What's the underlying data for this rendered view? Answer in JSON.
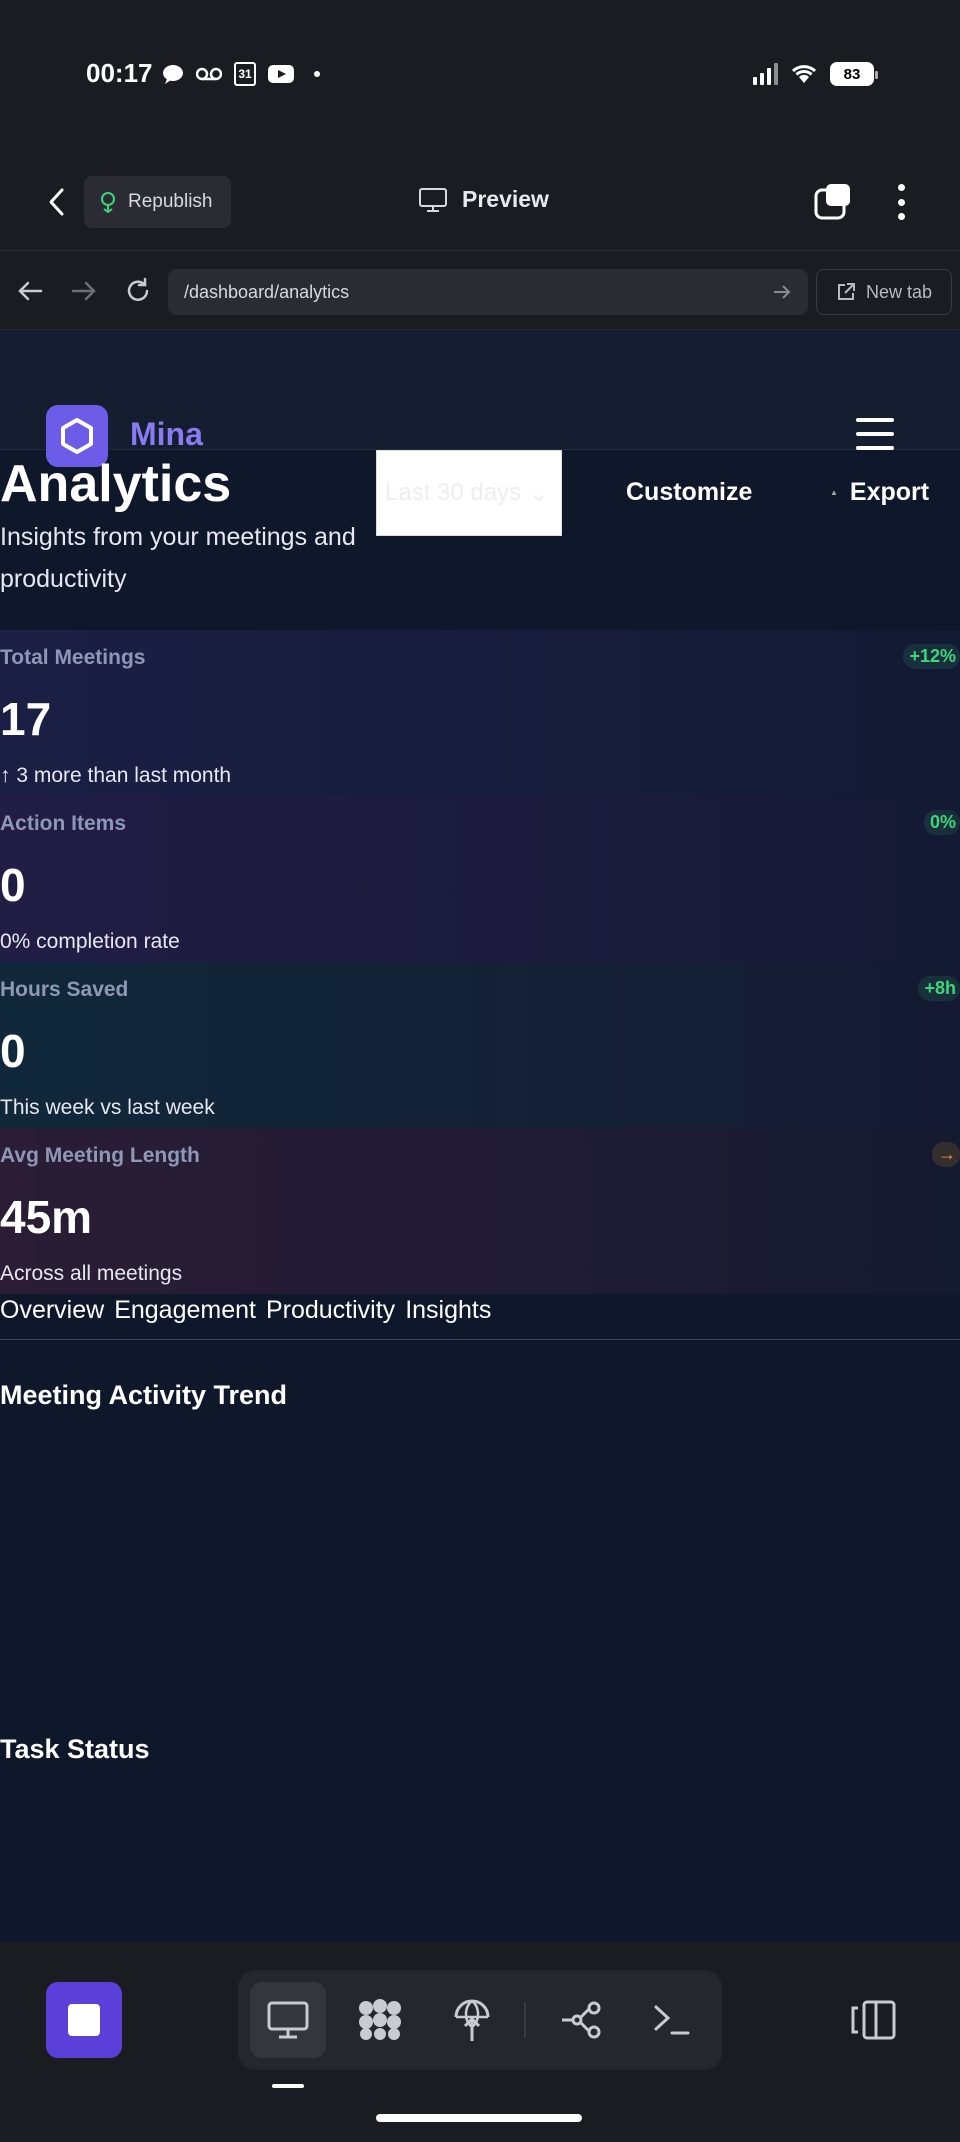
{
  "status_bar": {
    "time": "00:17",
    "battery": "83",
    "left_icons": [
      "chat-bubble-icon",
      "voicemail-icon",
      "calendar-icon",
      "youtube-icon"
    ],
    "calendar_day": "31"
  },
  "editor_bar": {
    "republish_label": "Republish",
    "preview_label": "Preview"
  },
  "url_bar": {
    "path": "/dashboard/analytics",
    "new_tab_label": "New tab"
  },
  "app": {
    "brand": "Mina",
    "title": "Analytics",
    "subtitle": "Insights from your meetings and productivity",
    "date_range": "Last 30 days",
    "customize_label": "Customize",
    "export_label": "Export",
    "metrics": [
      {
        "label": "Total Meetings",
        "value": "17",
        "note": "↑ 3 more than last month",
        "badge": "+12%",
        "badge_tone": "positive"
      },
      {
        "label": "Action Items",
        "value": "0",
        "note": "0% completion rate",
        "badge": "0%",
        "badge_tone": "positive"
      },
      {
        "label": "Hours Saved",
        "value": "0",
        "note": "This week vs last week",
        "badge": "+8h",
        "badge_tone": "positive"
      },
      {
        "label": "Avg Meeting Length",
        "value": "45m",
        "note": "Across all meetings",
        "badge": "→",
        "badge_tone": "neutral"
      }
    ],
    "tabs": [
      "Overview",
      "Engagement",
      "Productivity",
      "Insights"
    ],
    "sections": [
      "Meeting Activity Trend",
      "Task Status"
    ]
  },
  "colors": {
    "accent": "#6d5ce8",
    "brand_text": "#8a7cf0",
    "positive": "#3fd47a",
    "neutral": "#f0a030",
    "app_background": "#0f172a"
  }
}
